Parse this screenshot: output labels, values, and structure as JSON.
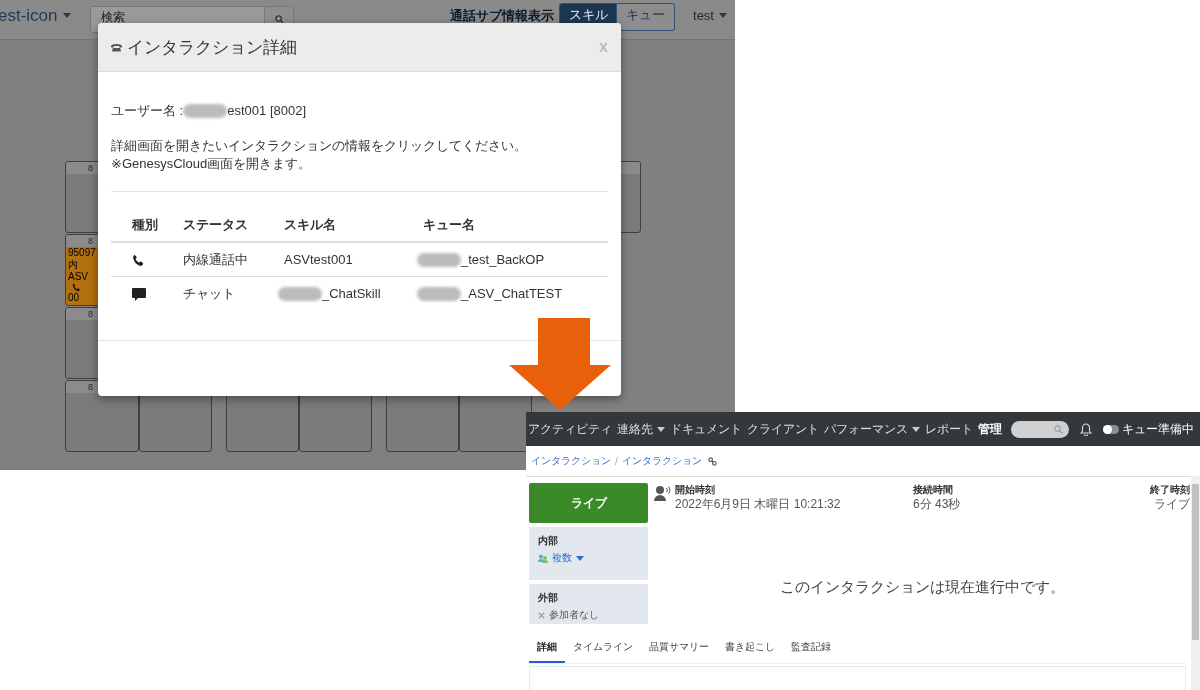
{
  "left_screen": {
    "header": {
      "brand": "est-icon",
      "search": {
        "placeholder": "検索"
      },
      "sub_info_label": "通話サブ情報表示",
      "view_toggle": [
        {
          "label": "スキル",
          "selected": true
        },
        {
          "label": "キュー",
          "selected": false
        }
      ],
      "user": "test"
    },
    "seat_grid": [
      [
        {
          "kind": "seat",
          "number": "8"
        },
        {
          "kind": "none"
        },
        {
          "kind": "none"
        },
        {
          "kind": "none"
        },
        {
          "kind": "none"
        },
        {
          "kind": "none"
        },
        {
          "kind": "seat"
        }
      ],
      [
        {
          "kind": "busy",
          "number": "8",
          "lines": [
            "95097",
            "内",
            "ASV"
          ],
          "time": "00"
        },
        {
          "kind": "none"
        },
        {
          "kind": "none"
        },
        {
          "kind": "none"
        },
        {
          "kind": "none"
        },
        {
          "kind": "none"
        },
        {
          "kind": "none"
        }
      ],
      [
        {
          "kind": "seat",
          "number": "8"
        },
        {
          "kind": "none"
        },
        {
          "kind": "none"
        },
        {
          "kind": "none"
        },
        {
          "kind": "none"
        },
        {
          "kind": "none"
        },
        {
          "kind": "none"
        }
      ],
      [
        {
          "kind": "seat",
          "number": "8"
        },
        {
          "kind": "seat"
        },
        {
          "kind": "seat"
        },
        {
          "kind": "seat"
        },
        {
          "kind": "seat"
        },
        {
          "kind": "seat"
        },
        {
          "kind": "none"
        }
      ]
    ]
  },
  "dialog": {
    "title": "インタラクション詳細",
    "close": "x",
    "user_label": "ユーザー名 :",
    "user_value": "est001 [8002]",
    "user_redacted": true,
    "instructions": [
      "詳細画面を開きたいインタラクションの情報をクリックしてください。",
      "※GenesysCloud画面を開きます。"
    ],
    "table": {
      "columns": [
        "種別",
        "ステータス",
        "スキル名",
        "キュー名"
      ],
      "rows": [
        {
          "kind": "phone",
          "status": "内線通話中",
          "skill": {
            "text": "ASVtest001",
            "redacted": false
          },
          "queue": {
            "text": "_test_BackOP",
            "redacted": true
          }
        },
        {
          "kind": "chat",
          "status": "チャット",
          "skill": {
            "text": "_ChatSkill",
            "redacted": true
          },
          "queue": {
            "text": "_ASV_ChatTEST",
            "redacted": true
          }
        }
      ]
    }
  },
  "right_screen": {
    "nav": [
      {
        "label": "アクティビティ",
        "dropdown": false,
        "selected": false
      },
      {
        "label": "連絡先",
        "dropdown": true,
        "selected": false
      },
      {
        "label": "ドキュメント",
        "dropdown": false,
        "selected": false
      },
      {
        "label": "クライアント",
        "dropdown": false,
        "selected": false
      },
      {
        "label": "パフォーマンス",
        "dropdown": true,
        "selected": false
      },
      {
        "label": "レポート",
        "dropdown": false,
        "selected": false
      },
      {
        "label": "管理",
        "dropdown": false,
        "selected": true
      }
    ],
    "queue_toggle": {
      "label": "キュー準備中",
      "on": false
    },
    "breadcrumb": [
      "インタラクション",
      "インタラクション"
    ],
    "breadcrumb_separator": "/",
    "status_button": "ライブ",
    "participants": [
      {
        "title": "内部",
        "value": "複数",
        "kind": "multiple"
      },
      {
        "title": "外部",
        "value": "参加者なし",
        "kind": "none"
      }
    ],
    "info": [
      {
        "label": "開始時刻",
        "value": "2022年6月9日 木曜日 10:21:32"
      },
      {
        "label": "接続時間",
        "value": "6分 43秒"
      },
      {
        "label": "終了時刻",
        "value": "ライブ"
      }
    ],
    "message": "このインタラクションは現在進行中です。",
    "tabs": [
      {
        "label": "詳細",
        "selected": true
      },
      {
        "label": "タイムライン",
        "selected": false
      },
      {
        "label": "品質サマリー",
        "selected": false
      },
      {
        "label": "書き起こし",
        "selected": false
      },
      {
        "label": "監査記録",
        "selected": false
      }
    ]
  }
}
